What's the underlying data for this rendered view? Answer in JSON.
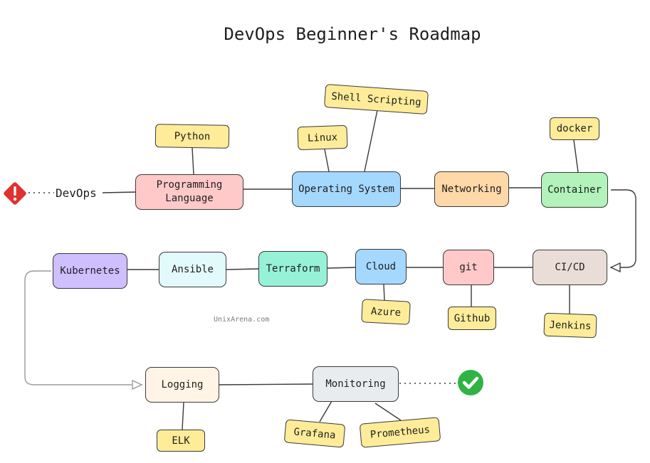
{
  "title": "DevOps Beginner's Roadmap",
  "start_label": "DevOps",
  "watermark": "UnixArena.com",
  "start_icon": "warning-diamond-icon",
  "end_icon": "check-circle-icon",
  "colors": {
    "warning": "#e03131",
    "success": "#2fb344",
    "tool": "#ffec99"
  },
  "steps": [
    {
      "id": "programming-language",
      "label": "Programming Language",
      "color": "#ffc9c9",
      "tools": [
        "Python"
      ]
    },
    {
      "id": "operating-system",
      "label": "Operating System",
      "color": "#a5d8ff",
      "tools": [
        "Linux",
        "Shell Scripting"
      ]
    },
    {
      "id": "networking",
      "label": "Networking",
      "color": "#ffd8a8",
      "tools": []
    },
    {
      "id": "container",
      "label": "Container",
      "color": "#b2f2bb",
      "tools": [
        "docker"
      ]
    },
    {
      "id": "ci-cd",
      "label": "CI/CD",
      "color": "#eaddd7",
      "tools": [
        "Jenkins"
      ]
    },
    {
      "id": "git",
      "label": "git",
      "color": "#ffc9c9",
      "tools": [
        "Github"
      ]
    },
    {
      "id": "cloud",
      "label": "Cloud",
      "color": "#a5d8ff",
      "tools": [
        "Azure"
      ]
    },
    {
      "id": "terraform",
      "label": "Terraform",
      "color": "#96f2d7",
      "tools": []
    },
    {
      "id": "ansible",
      "label": "Ansible",
      "color": "#e3fafc",
      "tools": []
    },
    {
      "id": "kubernetes",
      "label": "Kubernetes",
      "color": "#d0bfff",
      "tools": []
    },
    {
      "id": "logging",
      "label": "Logging",
      "color": "#fff4e6",
      "tools": [
        "ELK"
      ]
    },
    {
      "id": "monitoring",
      "label": "Monitoring",
      "color": "#e9ecef",
      "tools": [
        "Grafana",
        "Prometheus"
      ]
    }
  ]
}
